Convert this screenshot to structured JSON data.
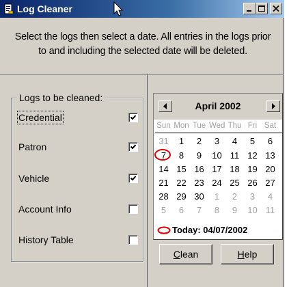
{
  "window": {
    "title": "Log Cleaner",
    "controls": {
      "minimize": "_",
      "maximize": "□",
      "close": "X"
    }
  },
  "instruction": {
    "line1": "Select the logs then select a date. All entries in the logs prior",
    "line2": "to and including the selected date will be deleted."
  },
  "logs_group": {
    "legend": "Logs to be cleaned:",
    "items": [
      {
        "label": "Credential",
        "checked": true
      },
      {
        "label": "Patron",
        "checked": true
      },
      {
        "label": "Vehicle",
        "checked": true
      },
      {
        "label": "Account Info",
        "checked": false
      },
      {
        "label": "History Table",
        "checked": false
      }
    ]
  },
  "calendar": {
    "month_label": "April 2002",
    "weekdays": [
      "Sun",
      "Mon",
      "Tue",
      "Wed",
      "Thu",
      "Fri",
      "Sat"
    ],
    "weeks": [
      [
        "31",
        "1",
        "2",
        "3",
        "4",
        "5",
        "6"
      ],
      [
        "7",
        "8",
        "9",
        "10",
        "11",
        "12",
        "13"
      ],
      [
        "14",
        "15",
        "16",
        "17",
        "18",
        "19",
        "20"
      ],
      [
        "21",
        "22",
        "23",
        "24",
        "25",
        "26",
        "27"
      ],
      [
        "28",
        "29",
        "30",
        "1",
        "2",
        "3",
        "4"
      ],
      [
        "5",
        "6",
        "7",
        "8",
        "9",
        "10",
        "11"
      ]
    ],
    "selected_day": "7",
    "today_label": "Today: 04/07/2002"
  },
  "buttons": {
    "clean": {
      "mnemonic": "C",
      "rest": "lean"
    },
    "help": {
      "mnemonic": "H",
      "rest": "elp"
    }
  },
  "colors": {
    "face": "#d4d0c8",
    "title_start": "#0a246a",
    "title_end": "#a6caf0",
    "circle": "#e00000",
    "muted_day": "#a0a0a0"
  }
}
